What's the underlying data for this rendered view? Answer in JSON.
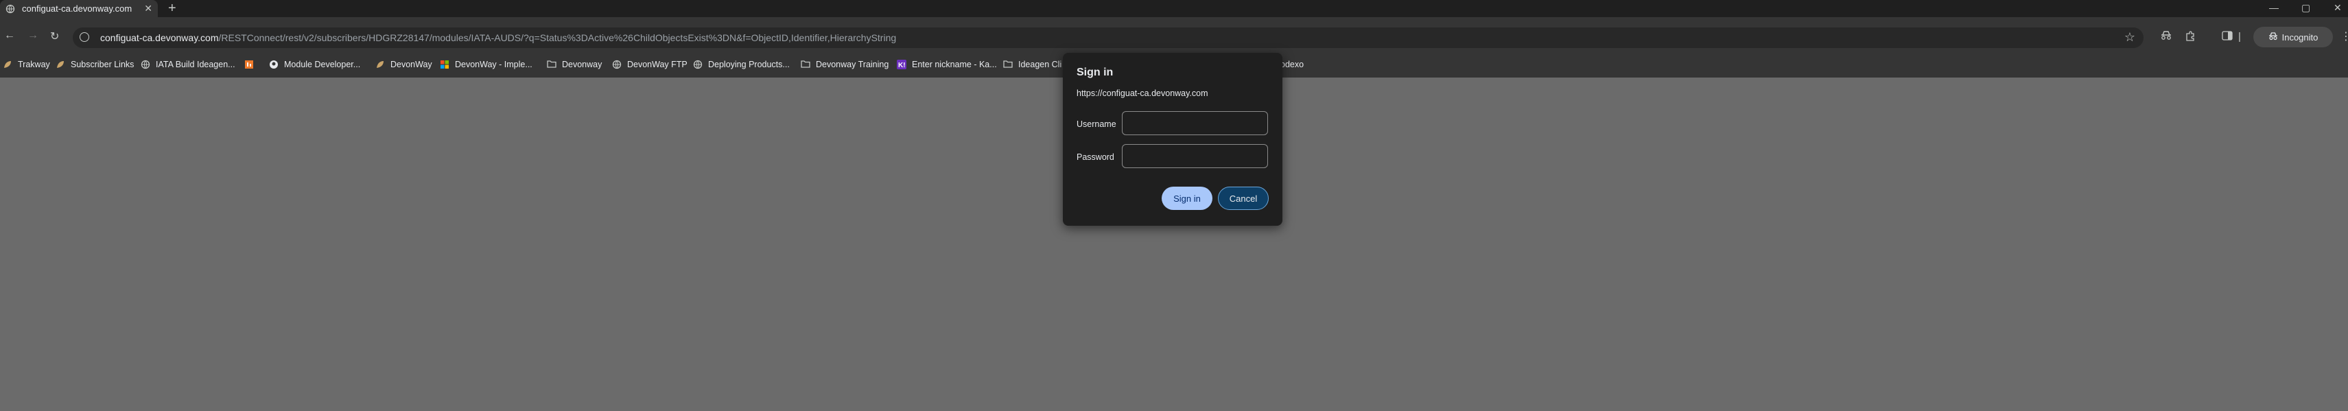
{
  "tab": {
    "title": "configuat-ca.devonway.com/RE",
    "new_tab": "+"
  },
  "window_controls": {
    "minimize": "—",
    "maximize": "▢",
    "close": "✕"
  },
  "nav": {
    "back": "←",
    "forward": "→",
    "reload": "↻"
  },
  "omnibox": {
    "host": "configuat-ca.devonway.com",
    "path": "/RESTConnect/rest/v2/subscribers/HDGRZ28147/modules/IATA-AUDS/?q=Status%3DActive%26ChildObjectsExist%3DN&f=ObjectID,Identifier,HierarchyString"
  },
  "incognito": {
    "label": "Incognito"
  },
  "bookmarks": [
    {
      "label": "Trakway",
      "icon": "leaf-icon",
      "color": "#c9a46a"
    },
    {
      "label": "Subscriber Links",
      "icon": "leaf-icon",
      "color": "#c9a46a"
    },
    {
      "label": "IATA Build Ideagen...",
      "icon": "globe-icon",
      "color": "#c4c7c5"
    },
    {
      "label": "",
      "icon": "orange-app-icon",
      "color": "#f07a2a"
    },
    {
      "label": "Module Developer...",
      "icon": "github-icon",
      "color": "#e8eaed"
    },
    {
      "label": "DevonWay",
      "icon": "leaf-icon",
      "color": "#c9a46a"
    },
    {
      "label": "DevonWay - Imple...",
      "icon": "microsoft-icon",
      "color": "#7fba00"
    },
    {
      "label": "Devonway",
      "icon": "folder-icon",
      "color": "#c4c7c5"
    },
    {
      "label": "DevonWay FTP",
      "icon": "globe-icon",
      "color": "#c4c7c5"
    },
    {
      "label": "Deploying Products...",
      "icon": "globe-icon",
      "color": "#c4c7c5"
    },
    {
      "label": "Devonway Training",
      "icon": "folder-icon",
      "color": "#c4c7c5"
    },
    {
      "label": "Enter nickname - Ka...",
      "icon": "kahoot-icon",
      "color": "#6c2fbf"
    },
    {
      "label": "Ideagen Cli",
      "icon": "folder-icon",
      "color": "#c4c7c5"
    },
    {
      "label": "odexo",
      "icon": "globe-icon",
      "color": "#c4c7c5"
    }
  ],
  "dialog": {
    "title": "Sign in",
    "url": "https://configuat-ca.devonway.com",
    "username_label": "Username",
    "password_label": "Password",
    "username_value": "",
    "password_value": "",
    "signin_label": "Sign in",
    "cancel_label": "Cancel"
  }
}
